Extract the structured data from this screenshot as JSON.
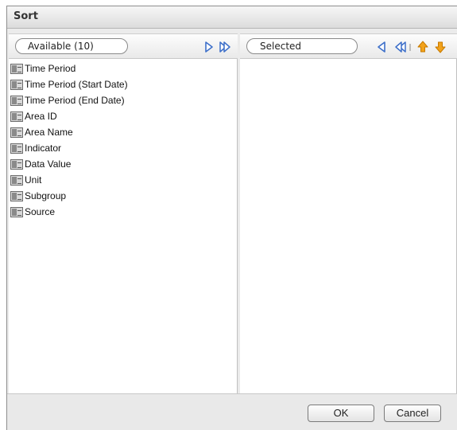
{
  "dialog": {
    "title": "Sort"
  },
  "available": {
    "header_label": "Available (10)",
    "items": [
      {
        "label": "Time Period"
      },
      {
        "label": "Time Period (Start Date)"
      },
      {
        "label": "Time Period (End Date)"
      },
      {
        "label": "Area ID"
      },
      {
        "label": "Area Name"
      },
      {
        "label": "Indicator"
      },
      {
        "label": "Data Value"
      },
      {
        "label": "Unit"
      },
      {
        "label": "Subgroup"
      },
      {
        "label": "Source"
      }
    ],
    "toolbar": [
      {
        "icon": "move-right-icon"
      },
      {
        "icon": "move-all-right-icon"
      }
    ]
  },
  "selected": {
    "header_label": "Selected",
    "items": [],
    "toolbar": [
      {
        "icon": "move-left-icon"
      },
      {
        "icon": "move-all-left-icon"
      },
      {
        "icon": "move-up-icon"
      },
      {
        "icon": "move-down-icon"
      }
    ]
  },
  "footer": {
    "ok_label": "OK",
    "cancel_label": "Cancel"
  },
  "colors": {
    "arrow_blue": "#3d6fc9",
    "arrow_orange": "#f2a21b",
    "dialog_bg": "#ebebeb"
  }
}
